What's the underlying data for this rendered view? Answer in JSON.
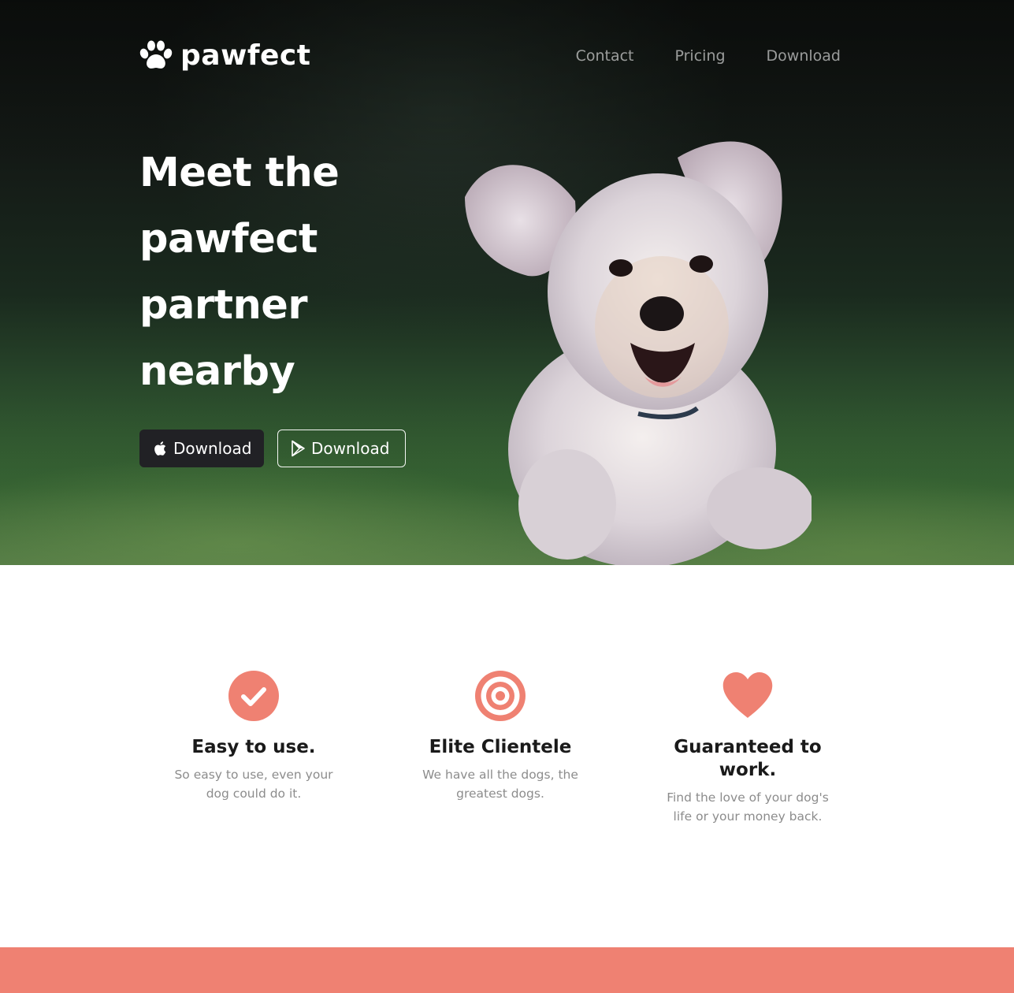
{
  "brand": {
    "name": "pawfect",
    "logo_icon": "paw-icon"
  },
  "nav": {
    "items": [
      {
        "label": "Contact"
      },
      {
        "label": "Pricing"
      },
      {
        "label": "Download"
      }
    ]
  },
  "hero": {
    "headline_lines": [
      "Meet the",
      "pawfect",
      "partner",
      "nearby"
    ],
    "image": "running-dog-photo",
    "buttons": [
      {
        "label": "Download",
        "icon": "apple-icon",
        "style": "dark"
      },
      {
        "label": "Download",
        "icon": "google-play-icon",
        "style": "outline"
      }
    ]
  },
  "features": [
    {
      "icon": "check-circle-icon",
      "title": "Easy to use.",
      "text": "So easy to use, even your dog could do it."
    },
    {
      "icon": "target-icon",
      "title": "Elite Clientele",
      "text": "We have all the dogs, the greatest dogs."
    },
    {
      "icon": "heart-icon",
      "title": "Guaranteed to work.",
      "text": "Find the love of your dog's life or your money back."
    }
  ],
  "colors": {
    "accent": "#ef8172",
    "dark_button": "#212125",
    "heading": "#1a1a1a",
    "muted_text": "#8c8c8c"
  }
}
